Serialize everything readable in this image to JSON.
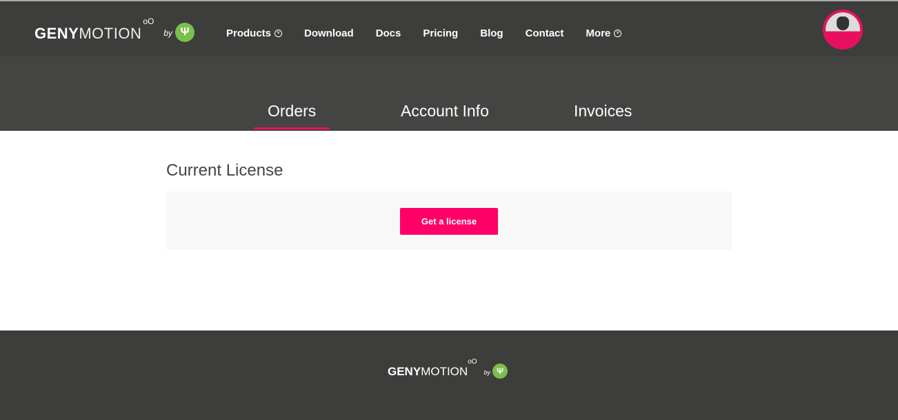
{
  "logo": {
    "bold": "GENY",
    "light": "MOTION",
    "oo": "oO",
    "by": "by",
    "mark": "Ψ"
  },
  "nav": [
    {
      "label": "Products",
      "dropdown": true
    },
    {
      "label": "Download"
    },
    {
      "label": "Docs"
    },
    {
      "label": "Pricing"
    },
    {
      "label": "Blog"
    },
    {
      "label": "Contact"
    },
    {
      "label": "More",
      "dropdown": true
    }
  ],
  "tabs": [
    {
      "label": "Orders",
      "active": true
    },
    {
      "label": "Account Info"
    },
    {
      "label": "Invoices"
    }
  ],
  "main": {
    "heading": "Current License",
    "button": "Get a license"
  },
  "colors": {
    "accent": "#ff0066",
    "header": "#3d3d3b",
    "brand_green": "#7bbf4b"
  }
}
